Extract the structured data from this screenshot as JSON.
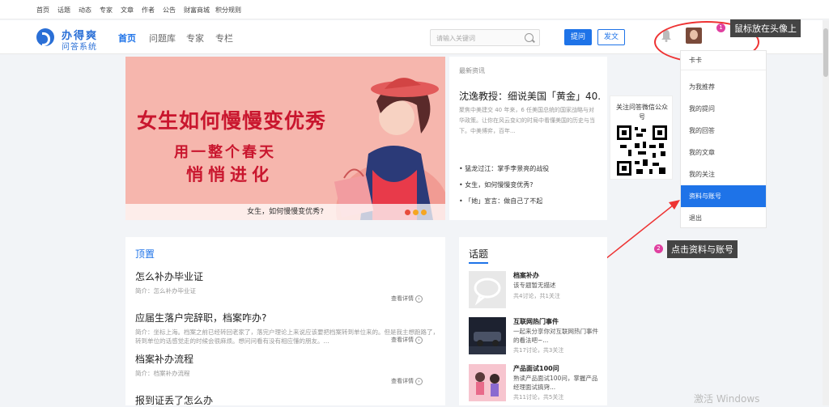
{
  "topbar": {
    "links": [
      "首页",
      "话题",
      "动态",
      "专家",
      "文章",
      "作者",
      "公告",
      "财富商城",
      "积分规则"
    ]
  },
  "header": {
    "logo_title": "办得爽",
    "logo_subtitle": "问答系统",
    "nav": [
      "首页",
      "问题库",
      "专家",
      "专栏"
    ],
    "search_placeholder": "请输入关键词",
    "ask_button": "提问",
    "post_button": "发文"
  },
  "annotations": {
    "step1_badge": "1",
    "step1_text": "鼠标放在头像上",
    "step2_badge": "2",
    "step2_text": "点击资料与账号",
    "color": "#e33333"
  },
  "banner": {
    "headline": "女生如何慢慢变优秀",
    "line2": "用一整个春天",
    "line3": "悄悄进化",
    "caption": "女生，如何慢慢变优秀?"
  },
  "news": {
    "header": "最新资讯",
    "title": "沈逸教授：细说美国「黄金」40...",
    "desc": "聚焦中美建交 40 年来，6 任美国总统的国家战略与对华政策。让你在风云变幻的时局中看懂美国的历史与当下。中美博弈，百年...",
    "items": [
      "猛龙过江：掌手李景亮的战役",
      "女生，如何慢慢变优秀?",
      "「她」宣言：做自己了不起"
    ]
  },
  "qr": {
    "label": "关注问答微信公众号"
  },
  "dropdown": {
    "username": "卡卡",
    "items": [
      "为我推荐",
      "我的提问",
      "我的回答",
      "我的文章",
      "我的关注",
      "资料与账号",
      "退出"
    ],
    "active_index": 5
  },
  "pinned": {
    "header": "顶置",
    "more_label": "查看详情",
    "questions": [
      {
        "title": "怎么补办毕业证",
        "desc": "简介：怎么补办毕业证"
      },
      {
        "title": "应届生落户完辞职，档案咋办?",
        "desc": "简介：坐标上海。档案之前已经转回老家了，落完户理论上来说应该要把档案转到单位来的。但是我主想跑路了，转到单位的话感觉走的时候会很麻烦。想问问看有没有相应懂的朋友。..."
      },
      {
        "title": "档案补办流程",
        "desc": "简介：档案补办流程"
      },
      {
        "title": "报到证丢了怎么办",
        "desc": ""
      }
    ]
  },
  "topics": {
    "header": "话题",
    "items": [
      {
        "title": "档案补办",
        "desc": "该专题暂无描述",
        "stats": "共4讨论，共1关注"
      },
      {
        "title": "互联网热门事件",
        "desc": "一起来分享你对互联网热门事件的看法吧~...",
        "stats": "共17讨论，共3关注"
      },
      {
        "title": "产品面试100问",
        "desc": "熟读产品面试100问，掌握产品经理面试搞窍...",
        "stats": "共11讨论，共5关注"
      }
    ]
  },
  "watermark": "激活 Windows"
}
